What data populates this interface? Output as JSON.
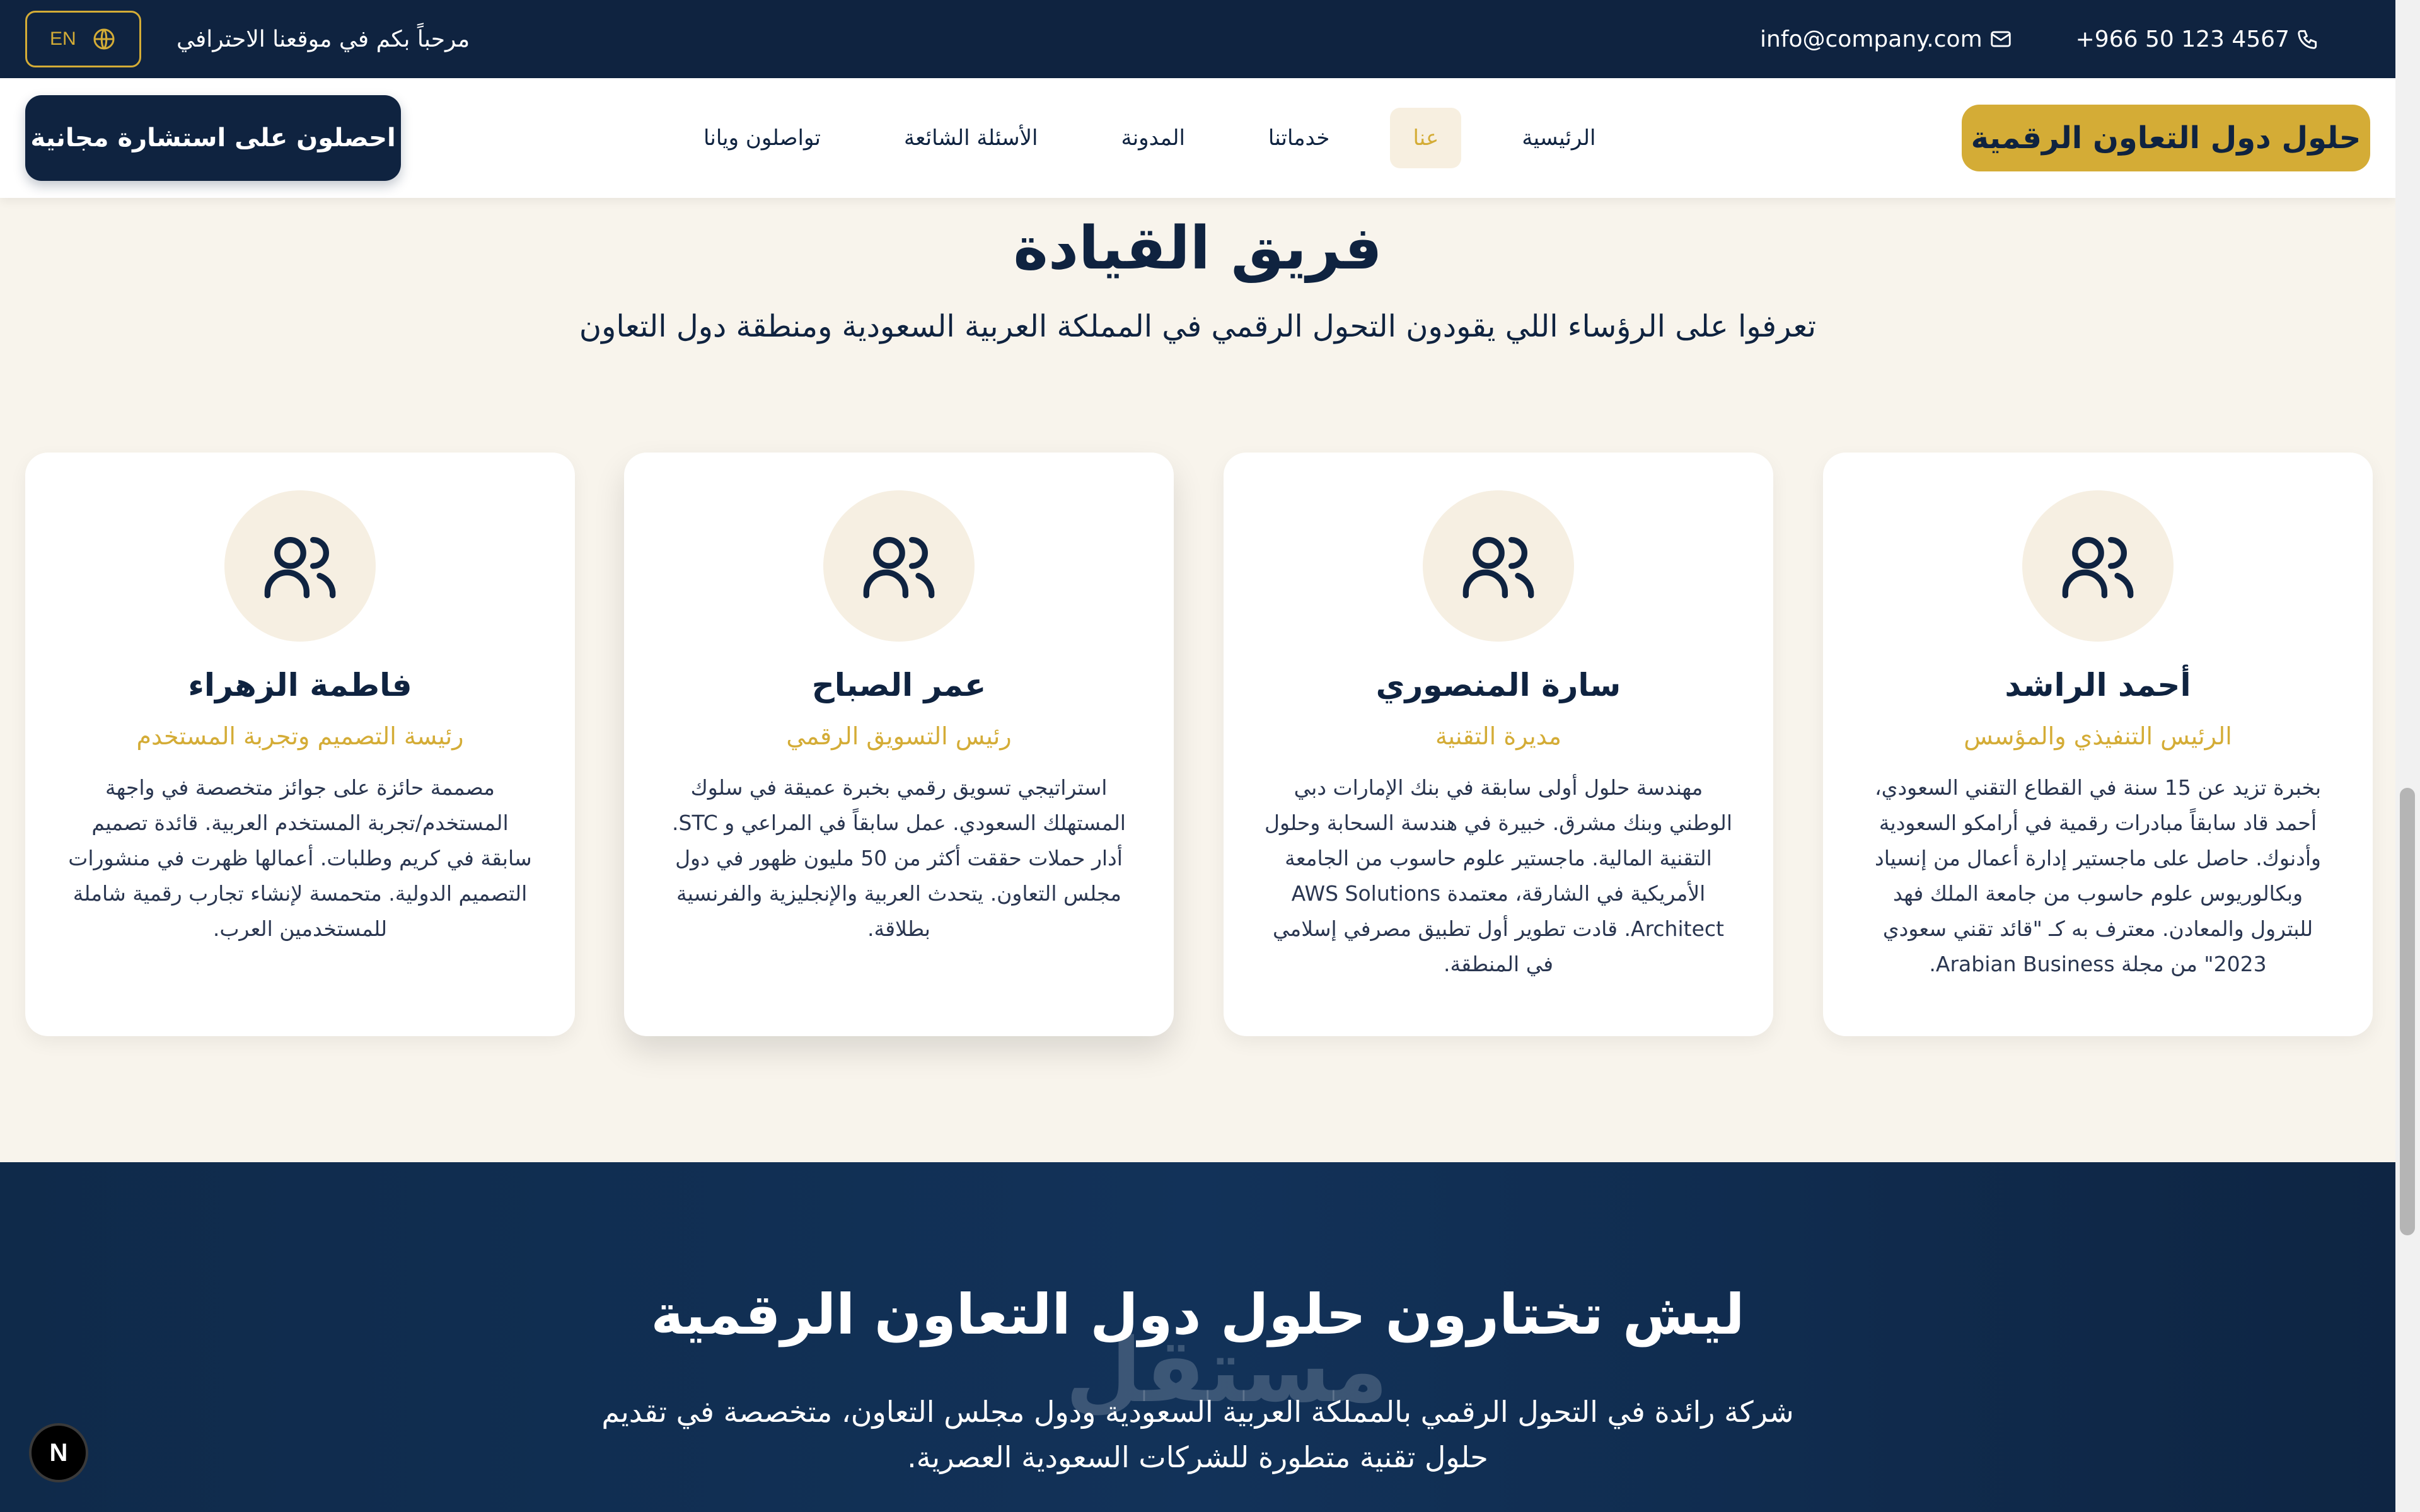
{
  "topbar": {
    "lang_label": "EN",
    "welcome": "مرحباً بكم في موقعنا الاحترافي",
    "email": "info@company.com",
    "phone": "+966 50 123 4567"
  },
  "nav": {
    "cta": "احصلون على استشارة مجانية",
    "brand": "حلول دول التعاون الرقمية",
    "links": [
      "الرئيسية",
      "عنا",
      "خدماتنا",
      "المدونة",
      "الأسئلة الشائعة",
      "تواصلون ويانا"
    ],
    "active_index": 1
  },
  "leadership": {
    "title": "فريق القيادة",
    "subtitle": "تعرفوا على الرؤساء اللي يقودون التحول الرقمي في المملكة العربية السعودية ومنطقة دول التعاون",
    "members": [
      {
        "name": "أحمد الراشد",
        "role": "الرئيس التنفيذي والمؤسس",
        "bio": "بخبرة تزيد عن 15 سنة في القطاع التقني السعودي، أحمد قاد سابقاً مبادرات رقمية في أرامكو السعودية وأدنوك. حاصل على ماجستير إدارة أعمال من إنسياد وبكالوريوس علوم حاسوب من جامعة الملك فهد للبترول والمعادن. معترف به كـ \"قائد تقني سعودي 2023\" من مجلة Arabian Business."
      },
      {
        "name": "سارة المنصوري",
        "role": "مديرة التقنية",
        "bio": "مهندسة حلول أولى سابقة في بنك الإمارات دبي الوطني وبنك مشرق. خبيرة في هندسة السحابة وحلول التقنية المالية. ماجستير علوم حاسوب من الجامعة الأمريكية في الشارقة، معتمدة AWS Solutions Architect. قادت تطوير أول تطبيق مصرفي إسلامي في المنطقة."
      },
      {
        "name": "عمر الصباح",
        "role": "رئيس التسويق الرقمي",
        "bio": "استراتيجي تسويق رقمي بخبرة عميقة في سلوك المستهلك السعودي. عمل سابقاً في المراعي و STC. أدار حملات حققت أكثر من 50 مليون ظهور في دول مجلس التعاون. يتحدث العربية والإنجليزية والفرنسية بطلاقة."
      },
      {
        "name": "فاطمة الزهراء",
        "role": "رئيسة التصميم وتجربة المستخدم",
        "bio": "مصممة حائزة على جوائز متخصصة في واجهة المستخدم/تجربة المستخدم العربية. قائدة تصميم سابقة في كريم وطلبات. أعمالها ظهرت في منشورات التصميم الدولية. متحمسة لإنشاء تجارب رقمية شاملة للمستخدمين العرب."
      }
    ]
  },
  "why": {
    "title": "ليش تختارون حلول دول التعاون الرقمية",
    "text": "شركة رائدة في التحول الرقمي بالمملكة العربية السعودية ودول مجلس التعاون، متخصصة في تقديم حلول تقنية متطورة للشركات السعودية العصرية.",
    "watermark": "مستقل"
  },
  "badge": "N",
  "colors": {
    "navy": "#0f2340",
    "gold": "#d4ac36",
    "cream": "#f8f4ec"
  }
}
